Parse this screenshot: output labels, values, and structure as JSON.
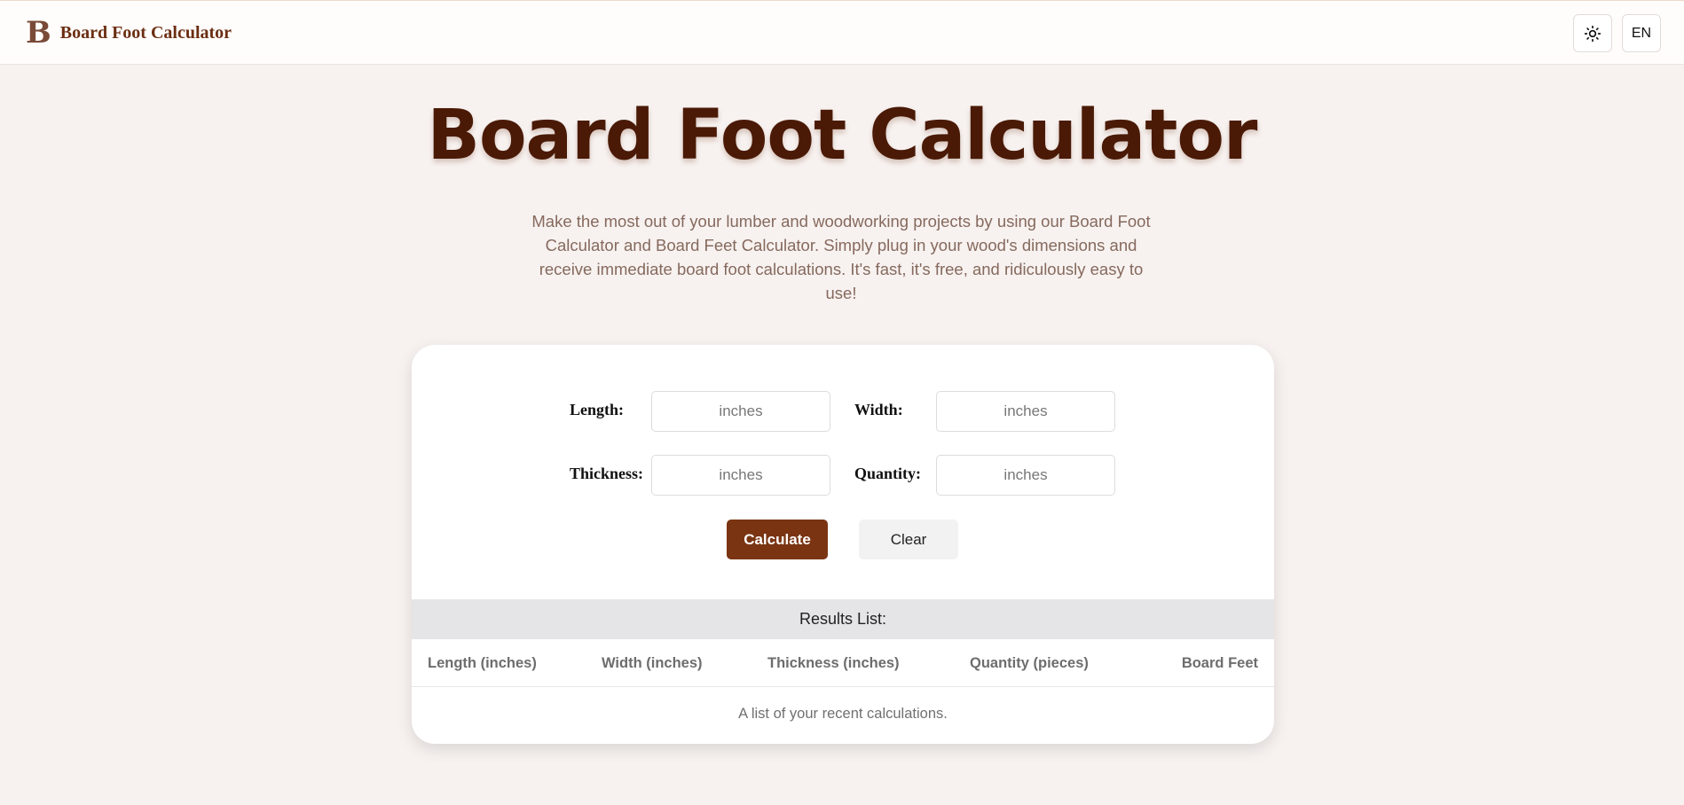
{
  "header": {
    "logo_mark": "B",
    "title": "Board Foot Calculator",
    "theme_icon": "sun-icon",
    "language": "EN"
  },
  "hero": {
    "title": "Board Foot Calculator",
    "description": "Make the most out of your lumber and woodworking projects by using our Board Foot Calculator and Board Feet Calculator. Simply plug in your wood's dimensions and receive immediate board foot calculations. It's fast, it's free, and ridiculously easy to use!"
  },
  "form": {
    "length_label": "Length:",
    "length_placeholder": "inches",
    "width_label": "Width:",
    "width_placeholder": "inches",
    "thickness_label": "Thickness:",
    "thickness_placeholder": "inches",
    "quantity_label": "Quantity:",
    "quantity_placeholder": "inches",
    "calculate_label": "Calculate",
    "clear_label": "Clear"
  },
  "results": {
    "title": "Results List:",
    "columns": [
      "Length (inches)",
      "Width (inches)",
      "Thickness (inches)",
      "Quantity (pieces)",
      "Board Feet"
    ],
    "empty_caption": "A list of your recent calculations."
  },
  "colors": {
    "accent": "#7a3412",
    "title": "#4a1a06",
    "background": "#f7f2f0"
  }
}
